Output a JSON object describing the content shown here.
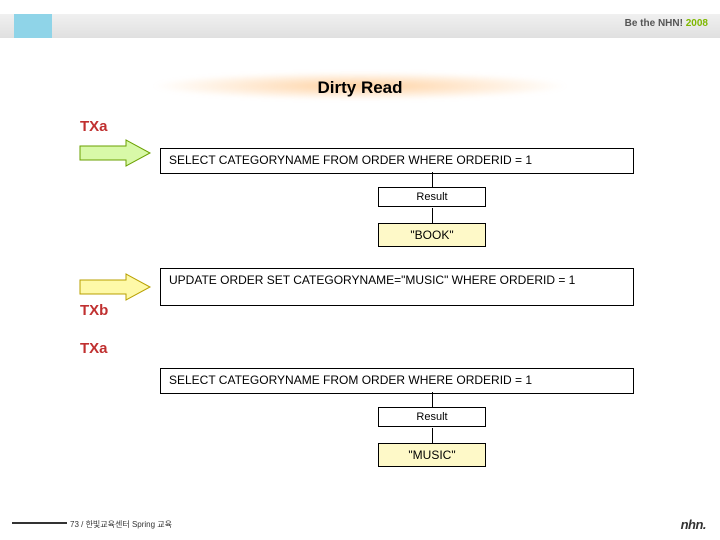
{
  "header": {
    "tagline_prefix": "Be the NHN!",
    "tagline_year": "2008"
  },
  "title": "Dirty Read",
  "labels": {
    "txa": "TXa",
    "txb": "TXb",
    "result": "Result"
  },
  "blocks": {
    "select1": "SELECT CATEGORYNAME FROM ORDER WHERE ORDERID = 1",
    "result1": "\"BOOK\"",
    "update": "UPDATE ORDER SET CATEGORYNAME=\"MUSIC\" WHERE ORDERID = 1",
    "select2": "SELECT CATEGORYNAME FROM ORDER WHERE ORDERID = 1",
    "result2": "\"MUSIC\""
  },
  "footer": "73 / 한빛교육센터 Spring 교육",
  "logo": "nhn."
}
